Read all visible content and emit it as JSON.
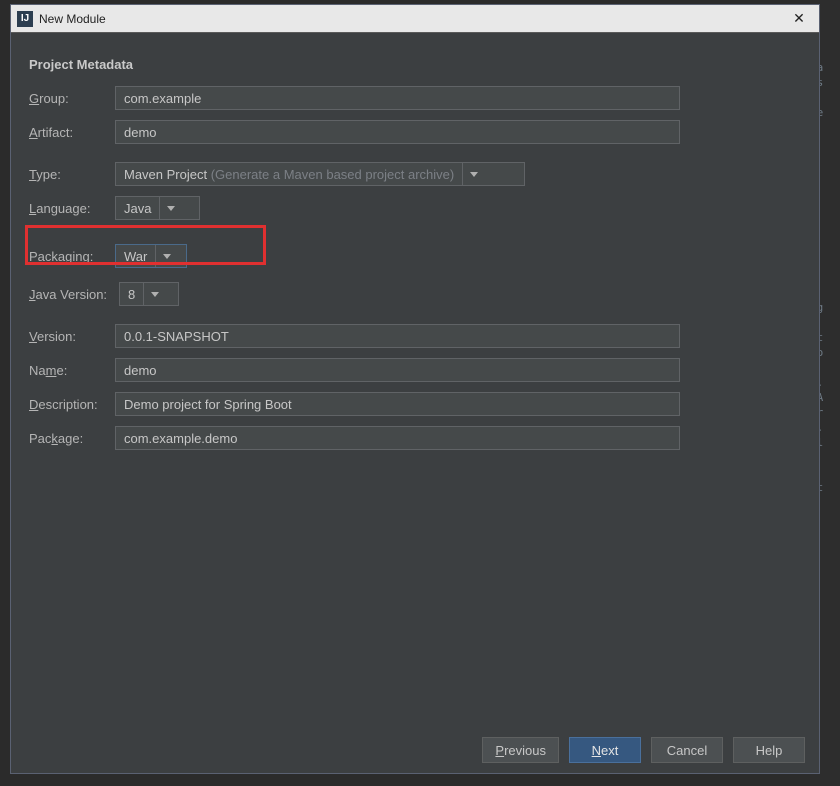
{
  "window": {
    "title": "New Module"
  },
  "section": {
    "title": "Project Metadata"
  },
  "labels": {
    "group": "Group:",
    "artifact": "Artifact:",
    "type": "Type:",
    "language": "Language:",
    "packaging": "Packaging:",
    "javaVersion": "Java Version:",
    "version": "Version:",
    "name": "Name:",
    "description": "Description:",
    "package": "Package:"
  },
  "values": {
    "group": "com.example",
    "artifact": "demo",
    "type": "Maven Project",
    "typeHint": "(Generate a Maven based project archive)",
    "language": "Java",
    "packaging": "War",
    "javaVersion": "8",
    "version": "0.0.1-SNAPSHOT",
    "name": "demo",
    "description": "Demo project for Spring Boot",
    "package": "com.example.demo"
  },
  "buttons": {
    "previous": "Previous",
    "next": "Next",
    "cancel": "Cancel",
    "help": "Help"
  }
}
